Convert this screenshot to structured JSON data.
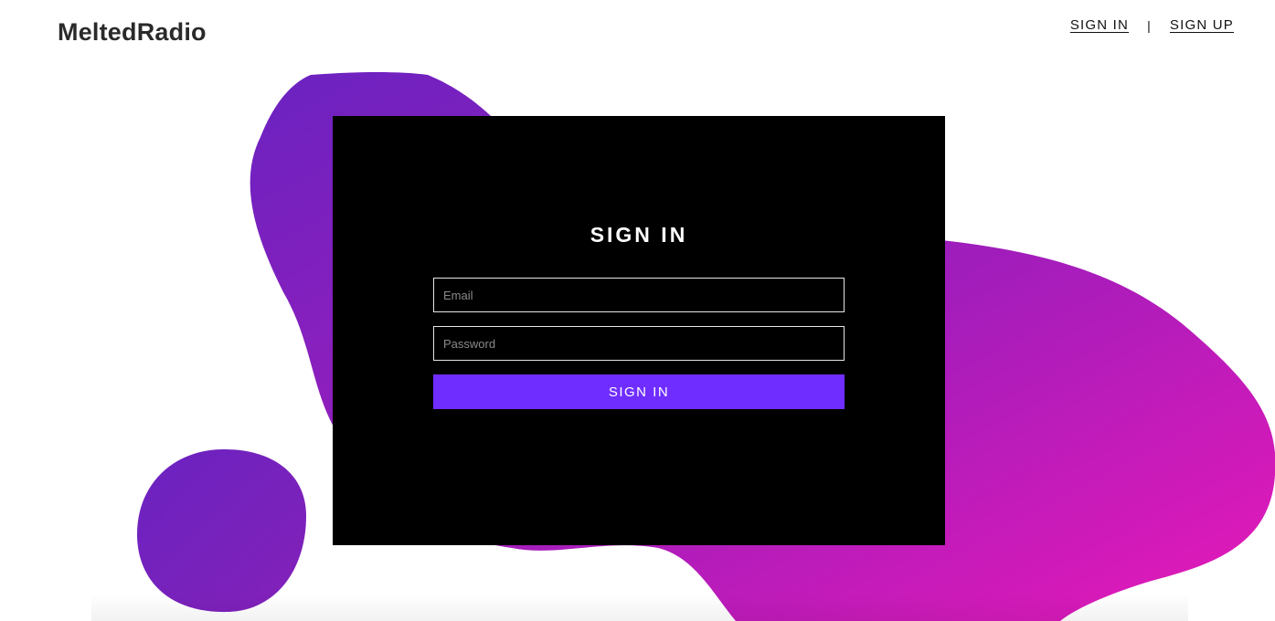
{
  "brand": {
    "name": "MeltedRadio"
  },
  "top_nav": {
    "sign_in": "SIGN IN",
    "separator": "|",
    "sign_up": "SIGN UP"
  },
  "signin_form": {
    "title": "SIGN IN",
    "email_placeholder": "Email",
    "email_value": "",
    "password_placeholder": "Password",
    "password_value": "",
    "submit_label": "SIGN IN"
  },
  "colors": {
    "card_background": "#000000",
    "button_accent": "#6f2dff",
    "blob_gradient_start": "#6a22c0",
    "blob_gradient_end": "#e719b8",
    "text_dark": "#2a2a2a"
  }
}
